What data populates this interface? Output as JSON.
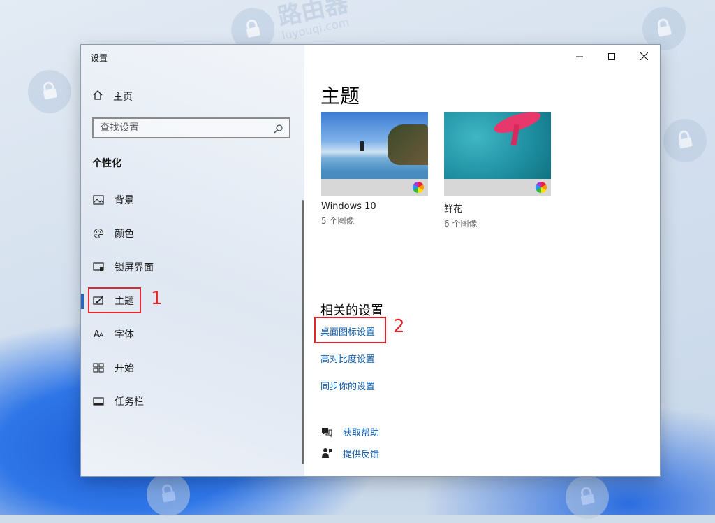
{
  "window": {
    "app_title": "设置",
    "controls": {
      "minimize": "minimize-icon",
      "maximize": "maximize-icon",
      "close": "close-icon"
    }
  },
  "sidebar": {
    "home_label": "主页",
    "search_placeholder": "查找设置",
    "section_title": "个性化",
    "items": [
      {
        "label": "背景",
        "icon": "picture-icon"
      },
      {
        "label": "颜色",
        "icon": "palette-icon"
      },
      {
        "label": "锁屏界面",
        "icon": "lock-screen-icon"
      },
      {
        "label": "主题",
        "icon": "theme-icon",
        "active": true
      },
      {
        "label": "字体",
        "icon": "font-icon"
      },
      {
        "label": "开始",
        "icon": "start-icon"
      },
      {
        "label": "任务栏",
        "icon": "taskbar-icon"
      }
    ]
  },
  "annotations": {
    "one": "1",
    "two": "2",
    "color": "#e0262a"
  },
  "main": {
    "title": "主题",
    "themes": [
      {
        "name": "Windows 10",
        "count": "5 个图像"
      },
      {
        "name": "鲜花",
        "count": "6 个图像"
      }
    ],
    "related_title": "相关的设置",
    "links": [
      "桌面图标设置",
      "高对比度设置",
      "同步你的设置"
    ],
    "help": [
      {
        "label": "获取帮助",
        "icon": "help-chat-icon"
      },
      {
        "label": "提供反馈",
        "icon": "feedback-icon"
      }
    ]
  },
  "watermark": {
    "brand": "路由器",
    "domain": "luyouqi.com"
  },
  "colors": {
    "accent": "#2864b8",
    "link": "#0b5cad",
    "highlight": "#e0262a"
  }
}
